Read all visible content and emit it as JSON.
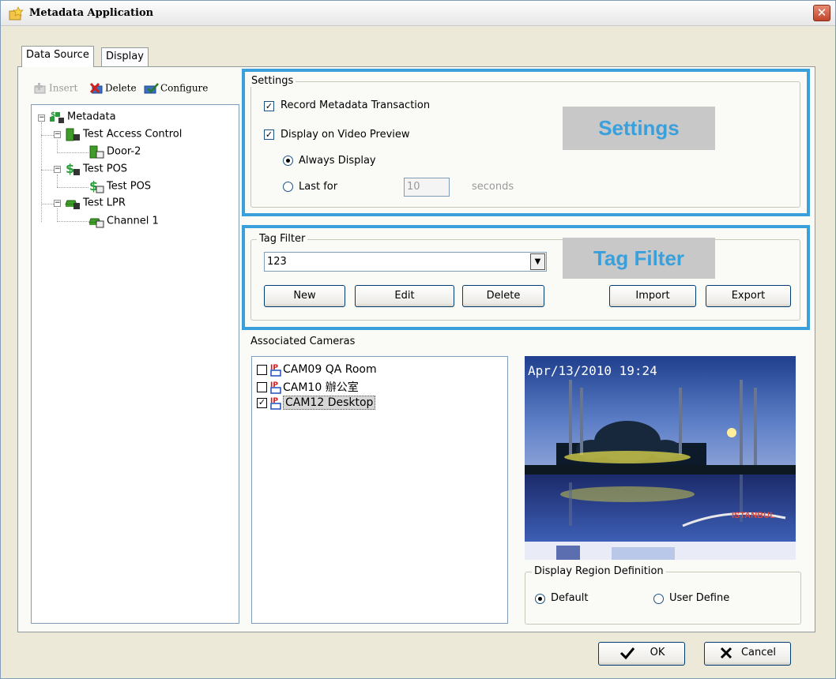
{
  "window": {
    "title": "Metadata Application",
    "close_glyph": "✕"
  },
  "tabs": [
    {
      "label": "Data Source",
      "active": true
    },
    {
      "label": "Display",
      "active": false
    }
  ],
  "toolbar": {
    "insert_label": "Insert",
    "delete_label": "Delete",
    "configure_label": "Configure"
  },
  "tree": {
    "root": "Metadata",
    "nodes": [
      {
        "label": "Test Access Control",
        "children": [
          "Door-2"
        ]
      },
      {
        "label": "Test POS",
        "children": [
          "Test POS"
        ]
      },
      {
        "label": "Test LPR",
        "children": [
          "Channel 1"
        ]
      }
    ]
  },
  "settings": {
    "group_label": "Settings",
    "watermark": "Settings",
    "record_transaction_label": "Record Metadata Transaction",
    "record_transaction_checked": true,
    "display_preview_label": "Display on Video Preview",
    "display_preview_checked": true,
    "always_display_label": "Always Display",
    "last_for_label": "Last for",
    "last_for_value": "10",
    "seconds_label": "seconds",
    "selected_mode": "always"
  },
  "tag_filter": {
    "group_label": "Tag Filter",
    "watermark": "Tag Filter",
    "selected_value": "123",
    "new_label": "New",
    "edit_label": "Edit",
    "delete_label": "Delete",
    "import_label": "Import",
    "export_label": "Export"
  },
  "associated_cameras": {
    "label": "Associated Cameras",
    "items": [
      {
        "name": "CAM09 QA Room",
        "checked": false,
        "check_glyph": ""
      },
      {
        "name": "CAM10 辦公室",
        "checked": false,
        "check_glyph": ""
      },
      {
        "name": "CAM12 Desktop",
        "checked": true,
        "check_glyph": "✓",
        "selected": true
      }
    ]
  },
  "preview": {
    "timestamp": "Apr/13/2010 19:24",
    "overlay_text": "ISTANBUL"
  },
  "display_region": {
    "group_label": "Display Region Definition",
    "default_label": "Default",
    "user_define_label": "User Define",
    "selected": "default"
  },
  "footer": {
    "ok_label": "OK",
    "cancel_label": "Cancel"
  },
  "colors": {
    "highlight": "#3aa0dc",
    "watermark_bg": "#c8c8c8"
  }
}
